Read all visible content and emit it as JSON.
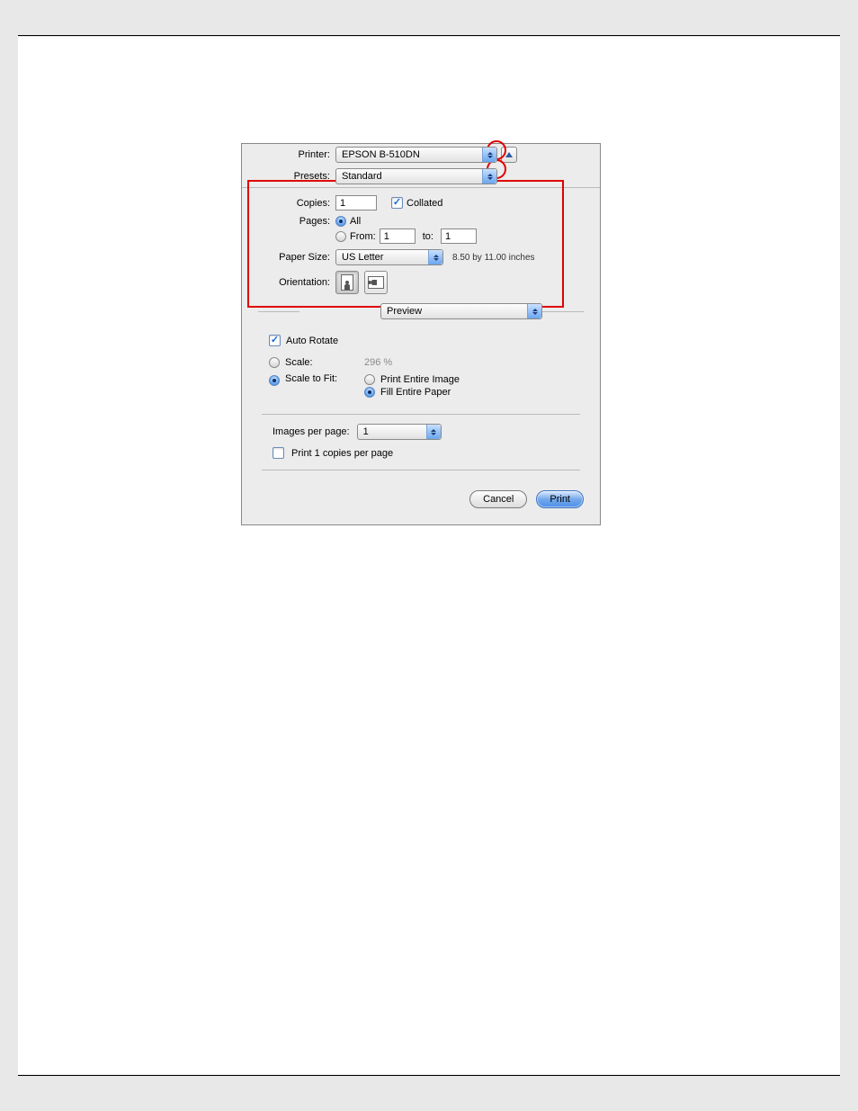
{
  "labels": {
    "printer": "Printer:",
    "presets": "Presets:",
    "copies": "Copies:",
    "pages": "Pages:",
    "from": "From:",
    "to": "to:",
    "paperSize": "Paper Size:",
    "orientation": "Orientation:",
    "imagesPerPage": "Images per page:"
  },
  "printer": {
    "value": "EPSON B-510DN"
  },
  "presets": {
    "value": "Standard"
  },
  "copies": {
    "value": "1",
    "collatedLabel": "Collated",
    "collated": true
  },
  "pages": {
    "allLabel": "All",
    "allSelected": true,
    "fromSelected": false,
    "fromValue": "1",
    "toValue": "1"
  },
  "paperSize": {
    "value": "US Letter",
    "dimensions": "8.50 by 11.00 inches"
  },
  "panel": {
    "value": "Preview"
  },
  "autoRotate": {
    "label": "Auto Rotate",
    "checked": true
  },
  "scale": {
    "label": "Scale:",
    "selected": false,
    "value": "296 %"
  },
  "scaleToFit": {
    "label": "Scale to Fit:",
    "selected": true,
    "printEntireLabel": "Print Entire Image",
    "printEntireSelected": false,
    "fillEntireLabel": "Fill Entire Paper",
    "fillEntireSelected": true
  },
  "imagesPerPage": {
    "value": "1"
  },
  "printNCopies": {
    "label": "Print 1 copies per page",
    "checked": false
  },
  "buttons": {
    "cancel": "Cancel",
    "print": "Print"
  }
}
